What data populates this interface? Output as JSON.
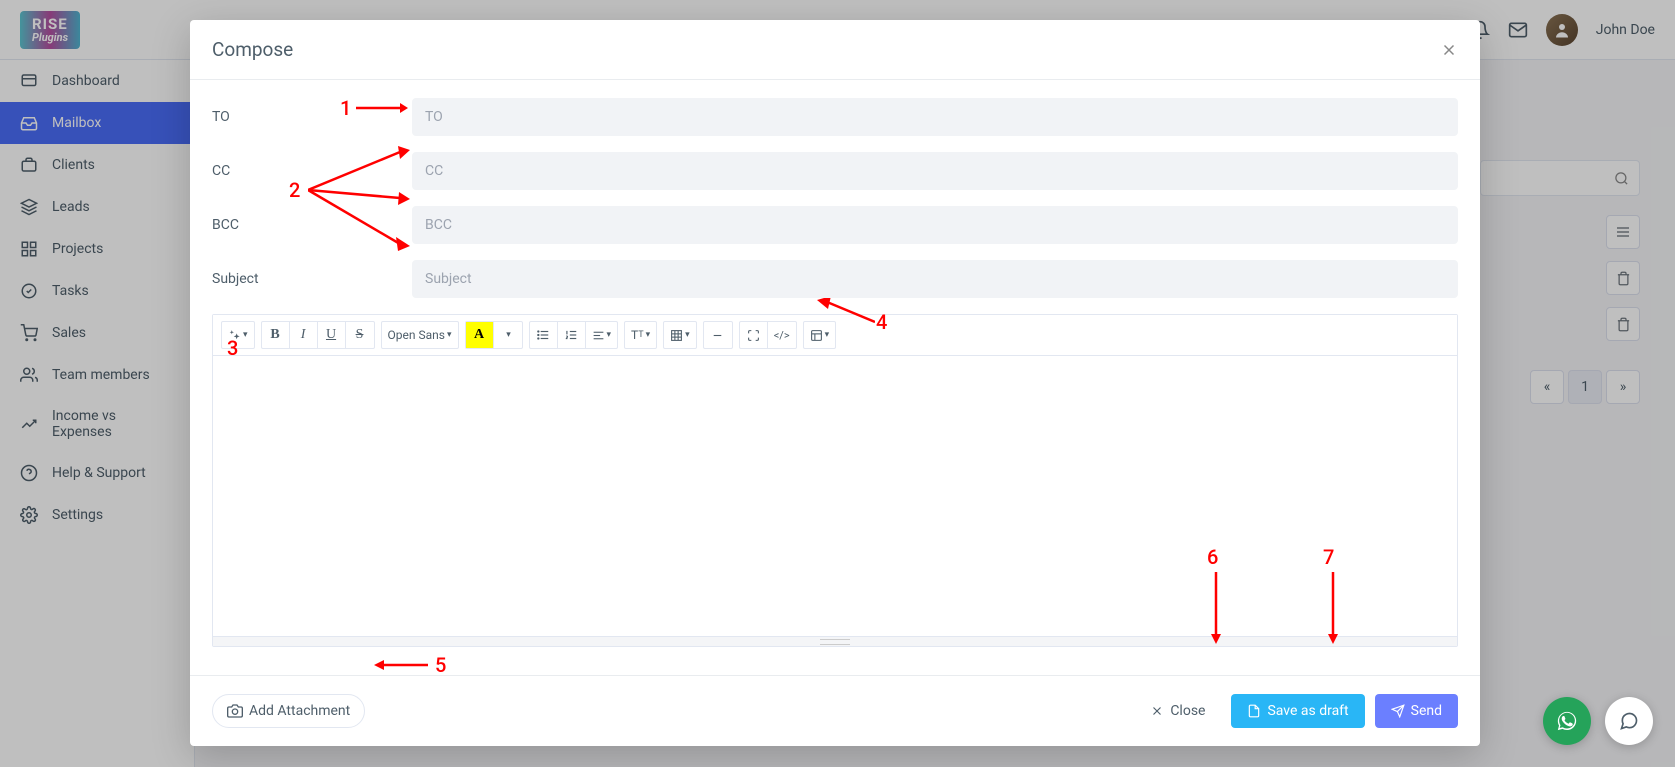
{
  "app": {
    "logo_line1": "RISE",
    "logo_line2": "Plugins"
  },
  "user": {
    "name": "John Doe"
  },
  "sidebar": {
    "items": [
      {
        "label": "Dashboard"
      },
      {
        "label": "Mailbox"
      },
      {
        "label": "Clients"
      },
      {
        "label": "Leads"
      },
      {
        "label": "Projects"
      },
      {
        "label": "Tasks"
      },
      {
        "label": "Sales"
      },
      {
        "label": "Team members"
      },
      {
        "label": "Income vs Expenses"
      },
      {
        "label": "Help & Support"
      },
      {
        "label": "Settings"
      }
    ]
  },
  "modal": {
    "title": "Compose",
    "labels": {
      "to": "TO",
      "cc": "CC",
      "bcc": "BCC",
      "subject": "Subject"
    },
    "placeholders": {
      "to": "TO",
      "cc": "CC",
      "bcc": "BCC",
      "subject": "Subject"
    },
    "toolbar": {
      "font": "Open Sans",
      "t_btn": "T",
      "a_btn": "A",
      "code_btn": "</>"
    },
    "footer": {
      "attach": "Add Attachment",
      "close": "Close",
      "draft": "Save as draft",
      "send": "Send"
    }
  },
  "annotations": {
    "n1": "1",
    "n2": "2",
    "n3": "3",
    "n4": "4",
    "n5": "5",
    "n6": "6",
    "n7": "7"
  },
  "bg": {
    "page": "1"
  }
}
